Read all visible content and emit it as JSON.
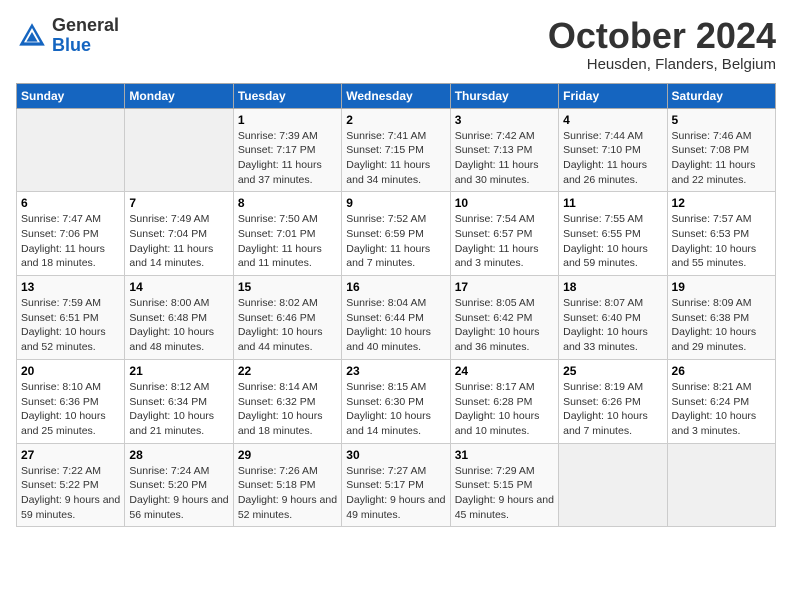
{
  "logo": {
    "line1": "General",
    "line2": "Blue"
  },
  "title": "October 2024",
  "location": "Heusden, Flanders, Belgium",
  "days_of_week": [
    "Sunday",
    "Monday",
    "Tuesday",
    "Wednesday",
    "Thursday",
    "Friday",
    "Saturday"
  ],
  "weeks": [
    [
      null,
      null,
      {
        "day": "1",
        "sunrise": "7:39 AM",
        "sunset": "7:17 PM",
        "daylight": "11 hours and 37 minutes."
      },
      {
        "day": "2",
        "sunrise": "7:41 AM",
        "sunset": "7:15 PM",
        "daylight": "11 hours and 34 minutes."
      },
      {
        "day": "3",
        "sunrise": "7:42 AM",
        "sunset": "7:13 PM",
        "daylight": "11 hours and 30 minutes."
      },
      {
        "day": "4",
        "sunrise": "7:44 AM",
        "sunset": "7:10 PM",
        "daylight": "11 hours and 26 minutes."
      },
      {
        "day": "5",
        "sunrise": "7:46 AM",
        "sunset": "7:08 PM",
        "daylight": "11 hours and 22 minutes."
      }
    ],
    [
      {
        "day": "6",
        "sunrise": "7:47 AM",
        "sunset": "7:06 PM",
        "daylight": "11 hours and 18 minutes."
      },
      {
        "day": "7",
        "sunrise": "7:49 AM",
        "sunset": "7:04 PM",
        "daylight": "11 hours and 14 minutes."
      },
      {
        "day": "8",
        "sunrise": "7:50 AM",
        "sunset": "7:01 PM",
        "daylight": "11 hours and 11 minutes."
      },
      {
        "day": "9",
        "sunrise": "7:52 AM",
        "sunset": "6:59 PM",
        "daylight": "11 hours and 7 minutes."
      },
      {
        "day": "10",
        "sunrise": "7:54 AM",
        "sunset": "6:57 PM",
        "daylight": "11 hours and 3 minutes."
      },
      {
        "day": "11",
        "sunrise": "7:55 AM",
        "sunset": "6:55 PM",
        "daylight": "10 hours and 59 minutes."
      },
      {
        "day": "12",
        "sunrise": "7:57 AM",
        "sunset": "6:53 PM",
        "daylight": "10 hours and 55 minutes."
      }
    ],
    [
      {
        "day": "13",
        "sunrise": "7:59 AM",
        "sunset": "6:51 PM",
        "daylight": "10 hours and 52 minutes."
      },
      {
        "day": "14",
        "sunrise": "8:00 AM",
        "sunset": "6:48 PM",
        "daylight": "10 hours and 48 minutes."
      },
      {
        "day": "15",
        "sunrise": "8:02 AM",
        "sunset": "6:46 PM",
        "daylight": "10 hours and 44 minutes."
      },
      {
        "day": "16",
        "sunrise": "8:04 AM",
        "sunset": "6:44 PM",
        "daylight": "10 hours and 40 minutes."
      },
      {
        "day": "17",
        "sunrise": "8:05 AM",
        "sunset": "6:42 PM",
        "daylight": "10 hours and 36 minutes."
      },
      {
        "day": "18",
        "sunrise": "8:07 AM",
        "sunset": "6:40 PM",
        "daylight": "10 hours and 33 minutes."
      },
      {
        "day": "19",
        "sunrise": "8:09 AM",
        "sunset": "6:38 PM",
        "daylight": "10 hours and 29 minutes."
      }
    ],
    [
      {
        "day": "20",
        "sunrise": "8:10 AM",
        "sunset": "6:36 PM",
        "daylight": "10 hours and 25 minutes."
      },
      {
        "day": "21",
        "sunrise": "8:12 AM",
        "sunset": "6:34 PM",
        "daylight": "10 hours and 21 minutes."
      },
      {
        "day": "22",
        "sunrise": "8:14 AM",
        "sunset": "6:32 PM",
        "daylight": "10 hours and 18 minutes."
      },
      {
        "day": "23",
        "sunrise": "8:15 AM",
        "sunset": "6:30 PM",
        "daylight": "10 hours and 14 minutes."
      },
      {
        "day": "24",
        "sunrise": "8:17 AM",
        "sunset": "6:28 PM",
        "daylight": "10 hours and 10 minutes."
      },
      {
        "day": "25",
        "sunrise": "8:19 AM",
        "sunset": "6:26 PM",
        "daylight": "10 hours and 7 minutes."
      },
      {
        "day": "26",
        "sunrise": "8:21 AM",
        "sunset": "6:24 PM",
        "daylight": "10 hours and 3 minutes."
      }
    ],
    [
      {
        "day": "27",
        "sunrise": "7:22 AM",
        "sunset": "5:22 PM",
        "daylight": "9 hours and 59 minutes."
      },
      {
        "day": "28",
        "sunrise": "7:24 AM",
        "sunset": "5:20 PM",
        "daylight": "9 hours and 56 minutes."
      },
      {
        "day": "29",
        "sunrise": "7:26 AM",
        "sunset": "5:18 PM",
        "daylight": "9 hours and 52 minutes."
      },
      {
        "day": "30",
        "sunrise": "7:27 AM",
        "sunset": "5:17 PM",
        "daylight": "9 hours and 49 minutes."
      },
      {
        "day": "31",
        "sunrise": "7:29 AM",
        "sunset": "5:15 PM",
        "daylight": "9 hours and 45 minutes."
      },
      null,
      null
    ]
  ]
}
